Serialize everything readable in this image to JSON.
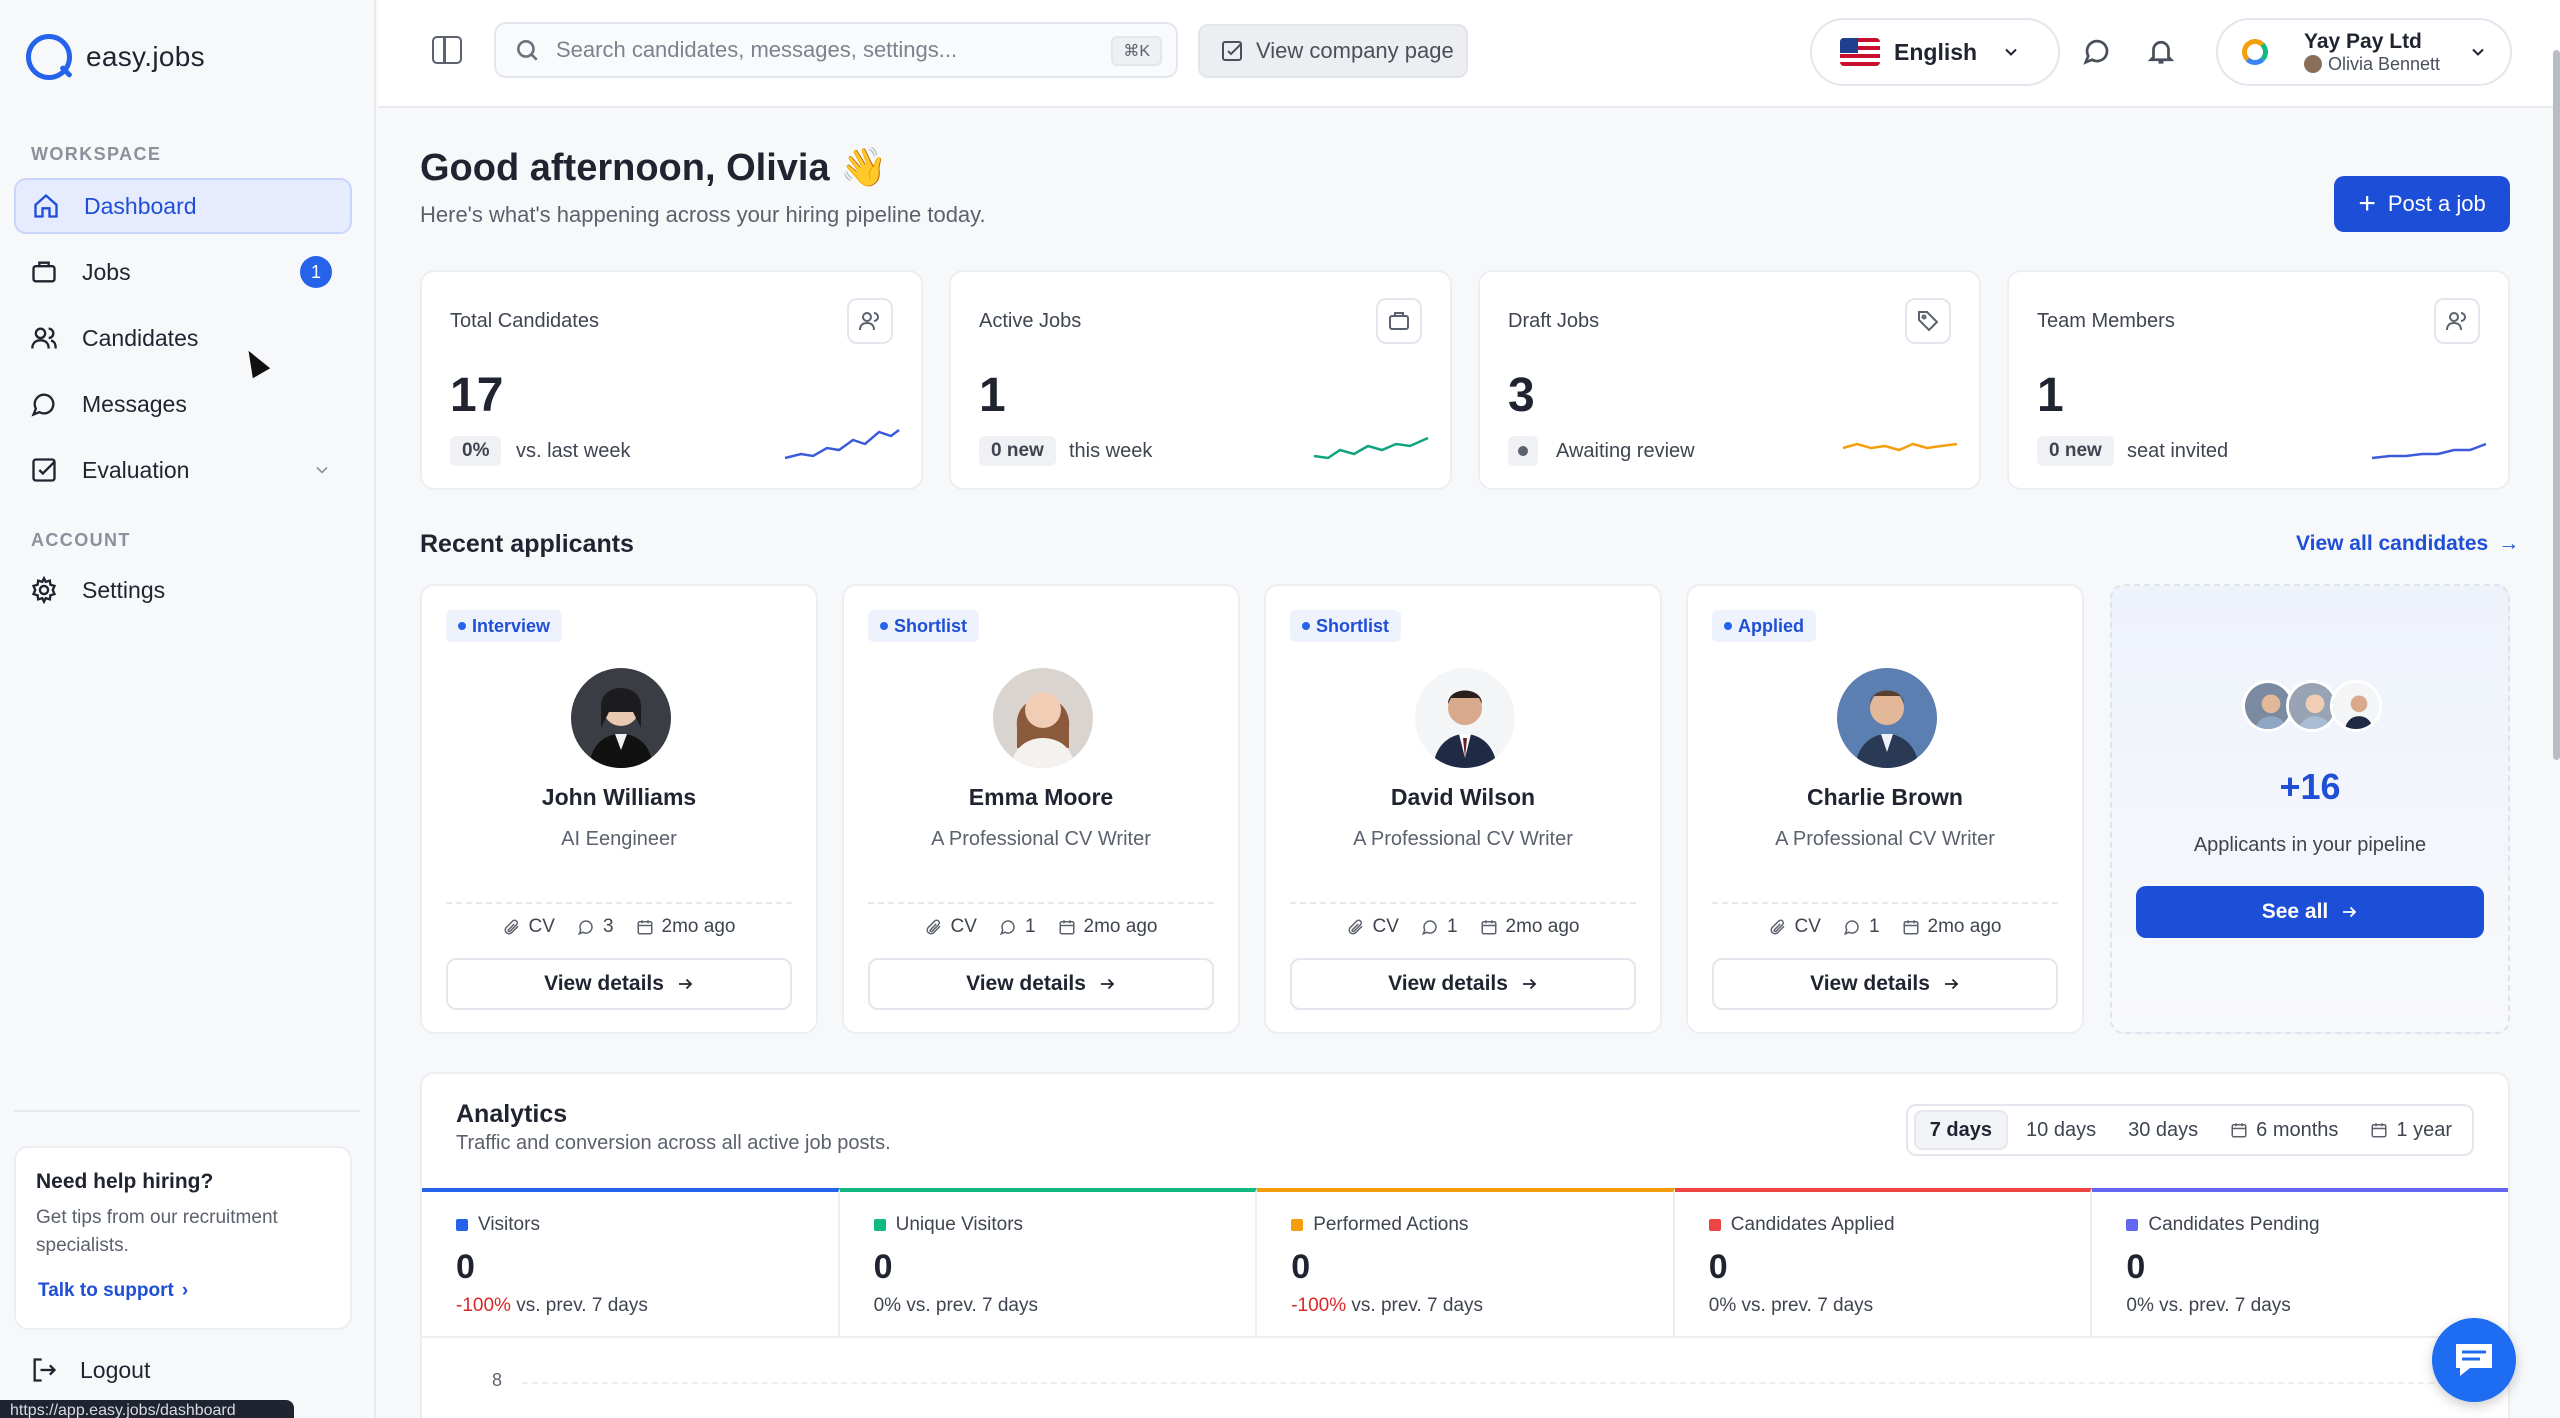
{
  "brand": {
    "name": "easy.jobs"
  },
  "sidebar": {
    "workspace_label": "WORKSPACE",
    "account_label": "ACCOUNT",
    "items": [
      {
        "label": "Dashboard",
        "icon": "home-icon"
      },
      {
        "label": "Jobs",
        "icon": "briefcase-icon",
        "badge": "1"
      },
      {
        "label": "Candidates",
        "icon": "users-icon"
      },
      {
        "label": "Messages",
        "icon": "chat-icon"
      },
      {
        "label": "Evaluation",
        "icon": "checkbox-icon"
      },
      {
        "label": "Settings",
        "icon": "gear-icon"
      }
    ],
    "help": {
      "title": "Need help hiring?",
      "text": "Get tips from our recruitment specialists.",
      "link": "Talk to support"
    },
    "logout": "Logout",
    "status_url": "https://app.easy.jobs/dashboard"
  },
  "topbar": {
    "search_placeholder": "Search candidates, messages, settings...",
    "search_shortcut": "⌘K",
    "company_page_label": "View company page",
    "language": "English",
    "account_company": "Yay Pay Ltd",
    "account_user": "Olivia Bennett"
  },
  "main": {
    "greeting": "Good afternoon, Olivia 👋",
    "subgreeting": "Here's what's happening across your hiring pipeline today.",
    "post_job_label": "Post a job",
    "stats": [
      {
        "title": "Total Candidates",
        "value": "17",
        "chip": "0%",
        "note": "vs. last week",
        "color": "#3b5bdb"
      },
      {
        "title": "Active Jobs",
        "value": "1",
        "chip": "0 new",
        "note": "this week",
        "color": "#10a37f"
      },
      {
        "title": "Draft Jobs",
        "value": "3",
        "chip": "",
        "note": "Awaiting review",
        "color": "#f59e0b"
      },
      {
        "title": "Team Members",
        "value": "1",
        "chip": "0 new",
        "note": "seat invited",
        "color": "#3b5bdb"
      }
    ],
    "recent_title": "Recent applicants",
    "view_all_label": "View all candidates",
    "candidates": [
      {
        "status": "Interview",
        "name": "John Williams",
        "role": "AI Eengineer",
        "cv": "CV",
        "comments": "3",
        "time": "2mo ago",
        "button": "View details"
      },
      {
        "status": "Shortlist",
        "name": "Emma Moore",
        "role": "A Professional CV Writer",
        "cv": "CV",
        "comments": "1",
        "time": "2mo ago",
        "button": "View details"
      },
      {
        "status": "Shortlist",
        "name": "David Wilson",
        "role": "A Professional CV Writer",
        "cv": "CV",
        "comments": "1",
        "time": "2mo ago",
        "button": "View details"
      },
      {
        "status": "Applied",
        "name": "Charlie Brown",
        "role": "A Professional CV Writer",
        "cv": "CV",
        "comments": "1",
        "time": "2mo ago",
        "button": "View details"
      }
    ],
    "pipeline": {
      "count": "+16",
      "text": "Applicants in your pipeline",
      "button": "See all"
    },
    "analytics": {
      "title": "Analytics",
      "subtitle": "Traffic and conversion across all active job posts.",
      "ranges": [
        "7 days",
        "10 days",
        "30 days",
        "6 months",
        "1 year"
      ],
      "active_range": "7 days",
      "metrics": [
        {
          "label": "Visitors",
          "value": "0",
          "change": "-100%",
          "note": "vs. prev. 7 days",
          "color": "#2563eb",
          "negative": true
        },
        {
          "label": "Unique Visitors",
          "value": "0",
          "change": "0%",
          "note": "vs. prev. 7 days",
          "color": "#10b981",
          "negative": false
        },
        {
          "label": "Performed Actions",
          "value": "0",
          "change": "-100%",
          "note": "vs. prev. 7 days",
          "color": "#f59e0b",
          "negative": true
        },
        {
          "label": "Candidates Applied",
          "value": "0",
          "change": "0%",
          "note": "vs. prev. 7 days",
          "color": "#ef4444",
          "negative": false
        },
        {
          "label": "Candidates Pending",
          "value": "0",
          "change": "0%",
          "note": "vs. prev. 7 days",
          "color": "#6366f1",
          "negative": false
        }
      ],
      "y_tick": "8"
    }
  }
}
